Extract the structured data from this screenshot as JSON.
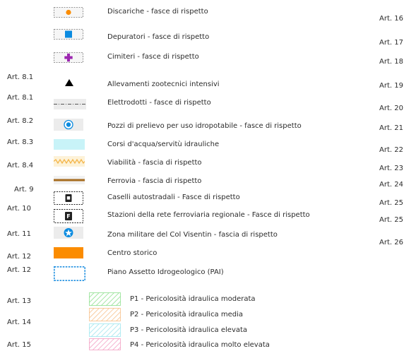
{
  "legend": {
    "items": [
      {
        "label": "Discariche -  fasce di rispetto",
        "symbol": "discarica-symbol"
      },
      {
        "label": "Depuratori - fasce di rispetto",
        "symbol": "depuratore-symbol"
      },
      {
        "label": "Cimiteri - fasce di rispetto",
        "symbol": "cimitero-symbol"
      },
      {
        "label": "Allevamenti zootecnici intensivi",
        "symbol": "allevamento-symbol"
      },
      {
        "label": "Elettrodotti - fasce di rispetto",
        "symbol": "elettrodotto-symbol"
      },
      {
        "label": "Pozzi di prelievo per uso idropotabile - fasce di rispetto",
        "symbol": "pozzo-symbol"
      },
      {
        "label": "Corsi d'acqua/servitù idrauliche",
        "symbol": "corso-acqua-symbol"
      },
      {
        "label": "Viabilità - fascia di rispetto",
        "symbol": "viabilita-symbol"
      },
      {
        "label": "Ferrovia - fascia di rispetto",
        "symbol": "ferrovia-symbol"
      },
      {
        "label": "Caselli autostradali - Fasce di rispetto",
        "symbol": "casello-symbol"
      },
      {
        "label": "Stazioni della rete ferroviaria regionale - Fasce di rispetto",
        "symbol": "stazione-symbol"
      },
      {
        "label": "Zona militare del Col Visentin - fascia di rispetto",
        "symbol": "zona-militare-symbol"
      },
      {
        "label": "Centro storico",
        "symbol": "centro-storico-symbol"
      },
      {
        "label": "Piano Assetto Idrogeologico (PAI)",
        "symbol": "pai-symbol"
      },
      {
        "label": "P1 - Pericolosità idraulica moderata",
        "symbol": "p1-symbol"
      },
      {
        "label": "P2 - Pericolosità idraulica media",
        "symbol": "p2-symbol"
      },
      {
        "label": "P3 - Pericolosità idraulica elevata",
        "symbol": "p3-symbol"
      },
      {
        "label": "P4 - Pericolosità idraulica molto elevata",
        "symbol": "p4-symbol"
      }
    ],
    "left_articles": [
      "Art. 8.1",
      "Art. 8.1",
      "Art. 8.2",
      "Art. 8.3",
      "Art. 8.4",
      "Art. 9",
      "Art. 10",
      "Art. 11",
      "Art. 12",
      "Art. 12",
      "Art. 13",
      "Art. 14",
      "Art. 15"
    ],
    "right_articles": [
      "Art. 16",
      "Art. 17",
      "Art. 18",
      "Art. 19",
      "Art. 20",
      "Art. 21",
      "Art. 22",
      "Art. 23",
      "Art. 24",
      "Art. 25",
      "Art. 25",
      "Art. 26"
    ]
  },
  "colors": {
    "orange": "#fb8c00",
    "blue": "#0b8be0",
    "purple": "#9c27b0",
    "light_cyan": "#c8f3f8",
    "brown": "#a66c1e",
    "pai_blue": "#1f8fe0",
    "p1_green": "#8fe08f",
    "p2_orange": "#f7c08a",
    "p3_cyan": "#9fe6ef",
    "p4_pink": "#f3a0c4"
  }
}
